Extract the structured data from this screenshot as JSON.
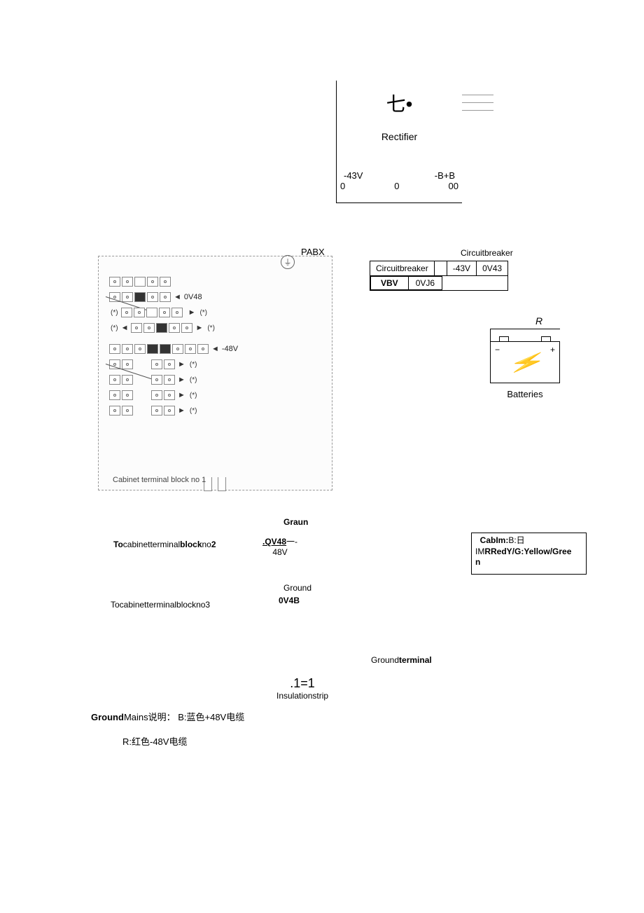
{
  "rectifier": {
    "symbol": "七•",
    "label": "Rectifier",
    "v_left": "-43V",
    "v_right": "-B+B",
    "b_zero1": "0",
    "b_zero2": "0",
    "b_zero3": "00"
  },
  "pabx": {
    "label": "PABX",
    "ground_icon": "⏚",
    "v_0v48": "0V48",
    "v_minus48": "-48V",
    "star": "(*)",
    "caption": "Cabinet terminal block no 1"
  },
  "breaker": {
    "title": "Circuitbreaker",
    "cell1": "Circuitbreaker",
    "cell_v": "-43V",
    "cell_v2": "0V43",
    "vbv": "VBV",
    "vj6": "0VJ6"
  },
  "battery": {
    "r": "R",
    "minus": "−",
    "plus": "+",
    "label": "Batteries"
  },
  "middle": {
    "graun": "Graun",
    "to_block2_to": "To",
    "to_block2_mid": "cabinetterminal",
    "to_block2_bold": "block",
    "to_block2_end": "no",
    "to_block2_num": "2",
    "qv48": ".QV48",
    "qv48_dash": "一-",
    "minus48": "48V",
    "ground_label": "Ground",
    "to_block3": "Tocabinetterminalblockno3",
    "v_0v4b": "0V4B"
  },
  "cabim": {
    "line1_a": "CabIm:",
    "line1_b": "B:日",
    "line2_a": "IM",
    "line2_b": "RRedY/G:Yellow/Gree",
    "line3": "n"
  },
  "bottom": {
    "ground_terminal_a": "Ground",
    "ground_terminal_b": "terminal",
    "ins_num": ".1=1",
    "ins_label": "Insulationstrip",
    "gm_ground": "Ground",
    "gm_mains": "Mains说明： B:蓝色+48V电缆",
    "r_red": "R:红色-48V电缆"
  }
}
